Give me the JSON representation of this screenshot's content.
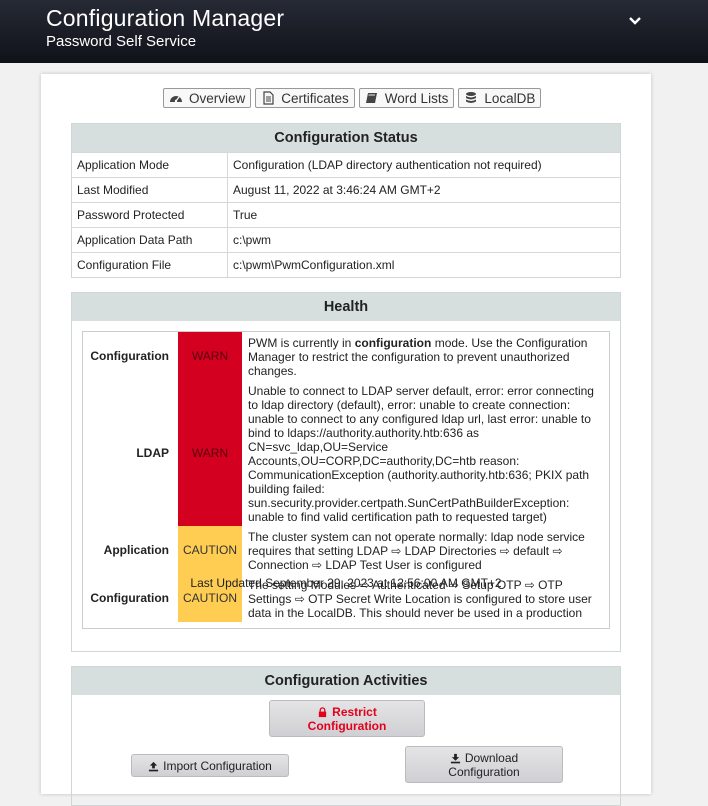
{
  "header": {
    "title": "Configuration Manager",
    "subtitle": "Password Self Service"
  },
  "tabs": [
    {
      "label": "Overview",
      "icon": "dashboard-icon"
    },
    {
      "label": "Certificates",
      "icon": "document-icon"
    },
    {
      "label": "Word Lists",
      "icon": "book-icon"
    },
    {
      "label": "LocalDB",
      "icon": "database-icon"
    }
  ],
  "status": {
    "heading": "Configuration Status",
    "rows": [
      {
        "key": "Application Mode",
        "value": "Configuration (LDAP directory authentication not required)"
      },
      {
        "key": "Last Modified",
        "value": "August 11, 2022 at 3:46:24 AM GMT+2"
      },
      {
        "key": "Password Protected",
        "value": "True"
      },
      {
        "key": "Application Data Path",
        "value": "c:\\pwm"
      },
      {
        "key": "Configuration File",
        "value": "c:\\pwm\\PwmConfiguration.xml"
      }
    ]
  },
  "health": {
    "heading": "Health",
    "rows": [
      {
        "topic": "Configuration",
        "status": "WARN",
        "pre": "PWM is currently in ",
        "bold": "configuration",
        "post": " mode. Use the Configuration Manager to restrict the configuration to prevent unauthorized changes."
      },
      {
        "topic": "LDAP",
        "status": "WARN",
        "pre": "Unable to connect to LDAP server default, error: error connecting to ldap directory (default), error: unable to create connection: unable to connect to any configured ldap url, last error: unable to bind to ldaps://authority.authority.htb:636 as CN=svc_ldap,OU=Service Accounts,OU=CORP,DC=authority,DC=htb reason: CommunicationException (authority.authority.htb:636; PKIX path building failed: sun.security.provider.certpath.SunCertPathBuilderException: unable to find valid certification path to requested target)",
        "bold": "",
        "post": ""
      },
      {
        "topic": "Application",
        "status": "CAUTION",
        "pre": "The cluster system can not operate normally: ldap node service requires that setting LDAP ⇨ LDAP Directories ⇨ default ⇨ Connection ⇨ LDAP Test User is configured",
        "bold": "",
        "post": ""
      },
      {
        "topic": "Configuration",
        "status": "CAUTION",
        "pre": "The setting Modules ⇨ Authenticated ⇨ Setup OTP ⇨ OTP Settings ⇨ OTP Secret Write Location is configured to store user data in the LocalDB. This should never be used in a production",
        "bold": "",
        "post": ""
      }
    ],
    "last_updated": "Last Updated September 29, 2023 at 12:56:00 AM GMT+2"
  },
  "activities": {
    "heading": "Configuration Activities",
    "restrict_line1": "Restrict",
    "restrict_line2": "Configuration",
    "import_label": "Import Configuration",
    "download_line1": "Download",
    "download_line2": "Configuration"
  },
  "colors": {
    "warn": "#d4001f",
    "caution": "#ffcd52",
    "section_header": "#d6dfde",
    "restrict_text": "#e4001b"
  }
}
